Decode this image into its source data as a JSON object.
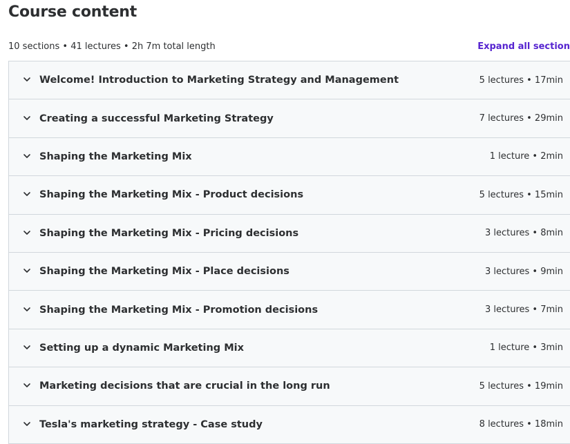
{
  "header": {
    "title": "Course content",
    "summary": "10 sections • 41 lectures • 2h 7m total length",
    "expand_label": "Expand all section"
  },
  "sections": [
    {
      "title": "Welcome! Introduction to Marketing Strategy and Management",
      "meta": "5 lectures • 17min"
    },
    {
      "title": "Creating a successful Marketing Strategy",
      "meta": "7 lectures • 29min"
    },
    {
      "title": "Shaping the Marketing Mix",
      "meta": "1 lecture • 2min"
    },
    {
      "title": "Shaping the Marketing Mix - Product decisions",
      "meta": "5 lectures • 15min"
    },
    {
      "title": "Shaping the Marketing Mix - Pricing decisions",
      "meta": "3 lectures • 8min"
    },
    {
      "title": "Shaping the Marketing Mix - Place decisions",
      "meta": "3 lectures • 9min"
    },
    {
      "title": "Shaping the Marketing Mix - Promotion decisions",
      "meta": "3 lectures • 7min"
    },
    {
      "title": "Setting up a dynamic Marketing Mix",
      "meta": "1 lecture • 3min"
    },
    {
      "title": "Marketing decisions that are crucial in the long run",
      "meta": "5 lectures • 19min"
    },
    {
      "title": "Tesla's marketing strategy - Case study",
      "meta": "8 lectures • 18min"
    }
  ],
  "icons": {
    "section_toggle": "chevron-down-icon"
  },
  "colors": {
    "text": "#2d2f31",
    "accent": "#5624d0",
    "section_bg": "#f7f9fa",
    "border": "#d1d7dc"
  }
}
